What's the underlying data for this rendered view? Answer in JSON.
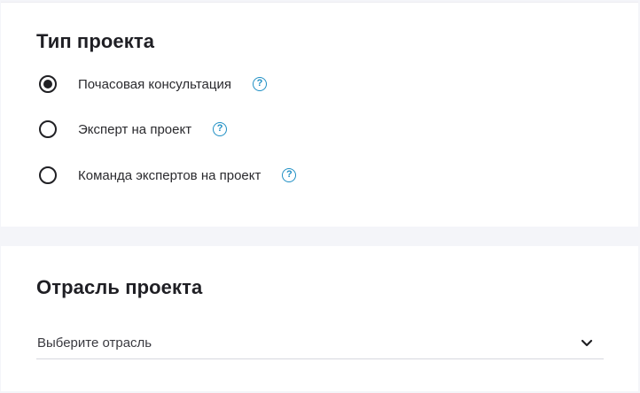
{
  "project_type": {
    "title": "Тип проекта",
    "options": [
      {
        "label": "Почасовая консультация",
        "selected": true,
        "help_icon": "question-circle-icon"
      },
      {
        "label": "Эксперт на проект",
        "selected": false,
        "help_icon": "question-circle-icon"
      },
      {
        "label": "Команда экспертов на проект",
        "selected": false,
        "help_icon": "question-circle-icon"
      }
    ],
    "help_glyph": "?"
  },
  "industry": {
    "title": "Отрасль проекта",
    "select_placeholder": "Выберите отрасль",
    "select_icon": "chevron-down-icon"
  },
  "colors": {
    "accent": "#1f8fc4",
    "text": "#1f1f24",
    "background": "#f4f5f9"
  }
}
